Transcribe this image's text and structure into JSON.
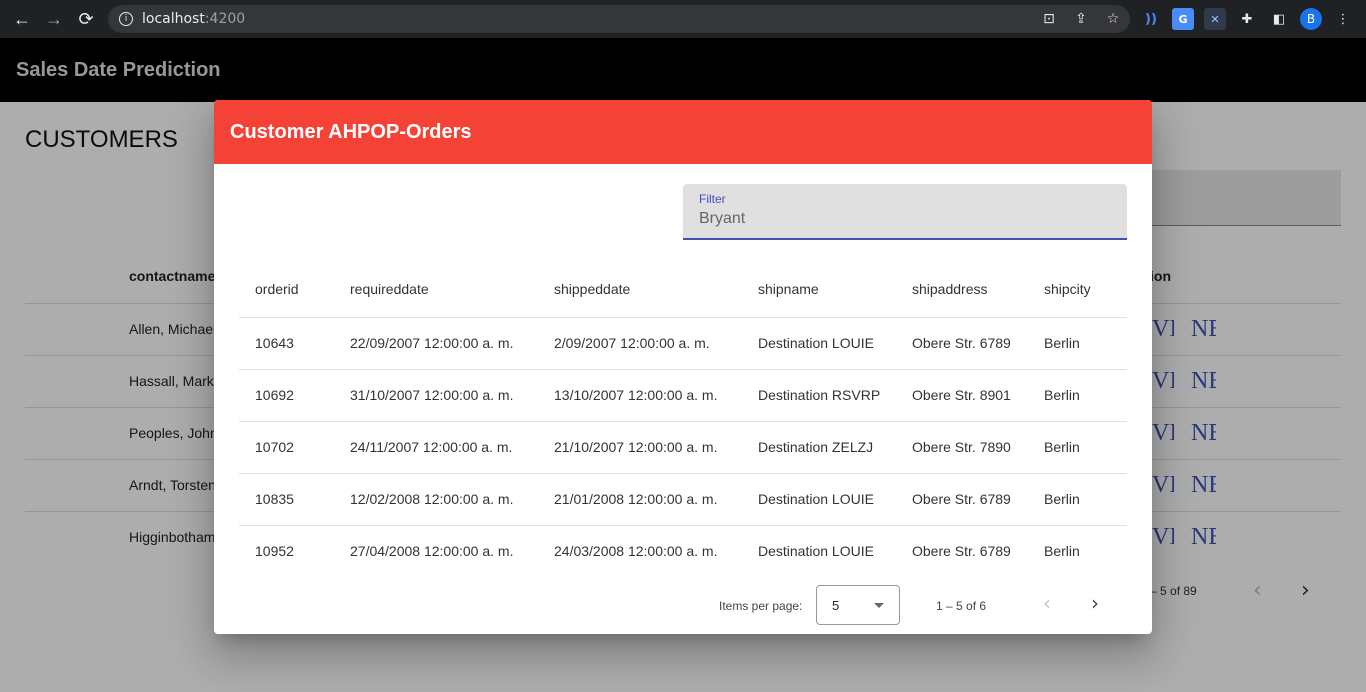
{
  "browser": {
    "url_host": "localhost",
    "url_port": ":4200",
    "back_glyph": "←",
    "forward_glyph": "→",
    "reload_glyph": "⟳",
    "info_glyph": "i",
    "omni_icons": [
      "translate-icon",
      "share-icon",
      "bookmark-star-icon"
    ],
    "extensions": [
      "wave-extension-icon",
      "google-translate-extension-icon",
      "x-extension-icon",
      "puzzle-extensions-icon",
      "side-panel-icon"
    ],
    "avatar_letter": "B",
    "menu_glyph": "⋮"
  },
  "app": {
    "title": "Sales Date Prediction"
  },
  "background": {
    "heading": "CUSTOMERS",
    "column_contactname": "contactname",
    "column_action": "ion",
    "rows": [
      {
        "name": "Allen, Michael",
        "act1": "VI",
        "act2": "NE"
      },
      {
        "name": "Hassall, Mark",
        "act1": "VI",
        "act2": "NE"
      },
      {
        "name": "Peoples, John",
        "act1": "VI",
        "act2": "NE"
      },
      {
        "name": "Arndt, Torsten",
        "act1": "VI",
        "act2": "NE"
      },
      {
        "name": "Higginbotham",
        "act1": "VI",
        "act2": "NE"
      }
    ],
    "pager_range": "– 5 of 89"
  },
  "dialog": {
    "title": "Customer AHPOP-Orders",
    "filter": {
      "label": "Filter",
      "value": "Bryant"
    },
    "columns": [
      "orderid",
      "requireddate",
      "shippeddate",
      "shipname",
      "shipaddress",
      "shipcity"
    ],
    "rows": [
      [
        "10643",
        "22/09/2007 12:00:00 a. m.",
        "2/09/2007 12:00:00 a. m.",
        "Destination LOUIE",
        "Obere Str. 6789",
        "Berlin"
      ],
      [
        "10692",
        "31/10/2007 12:00:00 a. m.",
        "13/10/2007 12:00:00 a. m.",
        "Destination RSVRP",
        "Obere Str. 8901",
        "Berlin"
      ],
      [
        "10702",
        "24/11/2007 12:00:00 a. m.",
        "21/10/2007 12:00:00 a. m.",
        "Destination ZELZJ",
        "Obere Str. 7890",
        "Berlin"
      ],
      [
        "10835",
        "12/02/2008 12:00:00 a. m.",
        "21/01/2008 12:00:00 a. m.",
        "Destination LOUIE",
        "Obere Str. 6789",
        "Berlin"
      ],
      [
        "10952",
        "27/04/2008 12:00:00 a. m.",
        "24/03/2008 12:00:00 a. m.",
        "Destination LOUIE",
        "Obere Str. 6789",
        "Berlin"
      ]
    ],
    "paginator": {
      "items_per_page_label": "Items per page:",
      "items_per_page": "5",
      "range": "1 – 5 of 6",
      "prev_glyph": "‹",
      "next_glyph": "›"
    }
  },
  "colors": {
    "dialog_header": "#f44336",
    "accent": "#3f51b5",
    "app_header": "#000000"
  }
}
